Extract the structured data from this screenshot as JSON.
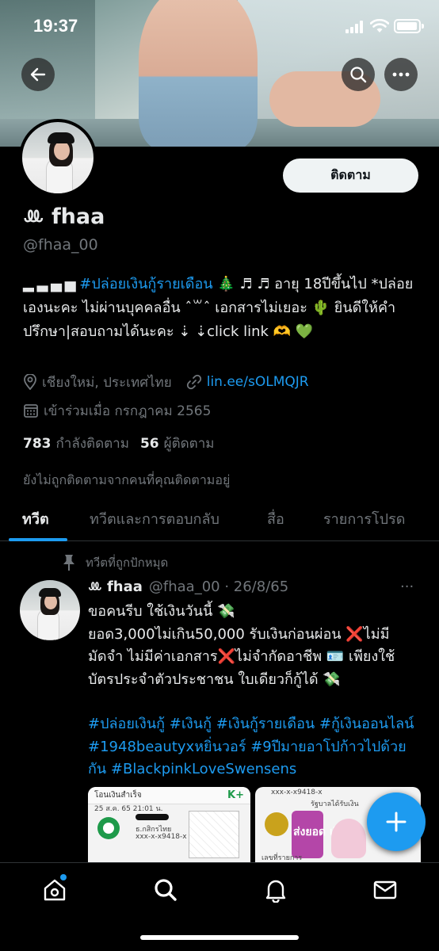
{
  "status_bar": {
    "time": "19:37"
  },
  "profile": {
    "display_name": "ꔛ fhaa",
    "handle": "@fhaa_00",
    "follow_label": "ติดตาม",
    "bio_blocks": "▂ ▃ ▄ ▅",
    "bio_hashtag": "#ปล่อยเงินกู้รายเดือน",
    "bio_line1_rest": " 🎄 ♬ ♬ อายุ 18ปีขึ้นไป *ปล่อยเองนะคะ ไม่ผ่านบุคคลอื่น ˆ꒳ˆ เอกสารไม่เยอะ 🌵 ยินดีให้คำปรึกษา|สอบถามได้นะคะ ⇣ ⇣click link 🫶 💚",
    "location": "เชียงใหม่, ประเทศไทย",
    "link": "lin.ee/sOLMQJR",
    "joined": "เข้าร่วมเมื่อ กรกฎาคม 2565",
    "following_count": "783",
    "following_label": "กำลังติดตาม",
    "followers_count": "56",
    "followers_label": "ผู้ติดตาม",
    "not_followed_note": "ยังไม่ถูกติดตามจากคนที่คุณติดตามอยู่"
  },
  "tabs": [
    {
      "label": "ทวีต"
    },
    {
      "label": "ทวีตและการตอบกลับ"
    },
    {
      "label": "สื่อ"
    },
    {
      "label": "รายการโปรด"
    }
  ],
  "pinned_tweet": {
    "pinned_label": "ทวีตที่ถูกปักหมุด",
    "author": "ꔛ fhaa",
    "handle_date": "@fhaa_00 · 26/8/65",
    "more": "···",
    "body_line1": "ขอคนรีบ ใช้เงินวันนี้ 💸",
    "body_line2": "ยอด3,000ไม่เกิน50,000 รับเงินก่อนผ่อน ❌ไม่มีมัดจำ ไม่มีค่าเอกสาร❌ไม่จำกัดอาชีพ 🪪 เพียงใช้บัตรประจำตัวประชาชน ใบเดียวก็กู้ได้ 💸",
    "hashtags": "#ปล่อยเงินกู้ #เงินกู้ #เงินกู้รายเดือน #กู้เงินออนไลน์ #1948beautyxหยิ่นวอร์ #9ปีมายอาโปก้าวไปด้วยกัน #BlackpinkLoveSwensens",
    "media": [
      {
        "top_text": "โอนเงินสำเร็จ",
        "sub_text": "25 ส.ค. 65 21:01 น.",
        "brand": "K+",
        "bank": "ธ.กสิกรไทย",
        "acct": "xxx-x-x9418-x"
      },
      {
        "acct": "xxx-x-x9418-x",
        "caption": "ส่งยอด เรียบ",
        "sub": "รัฐบาลได้รับเงิน",
        "ref": "เลขที่รายการ"
      }
    ]
  },
  "colors": {
    "accent": "#1d9bf0",
    "background": "#000000",
    "secondary_text": "#71767b"
  }
}
